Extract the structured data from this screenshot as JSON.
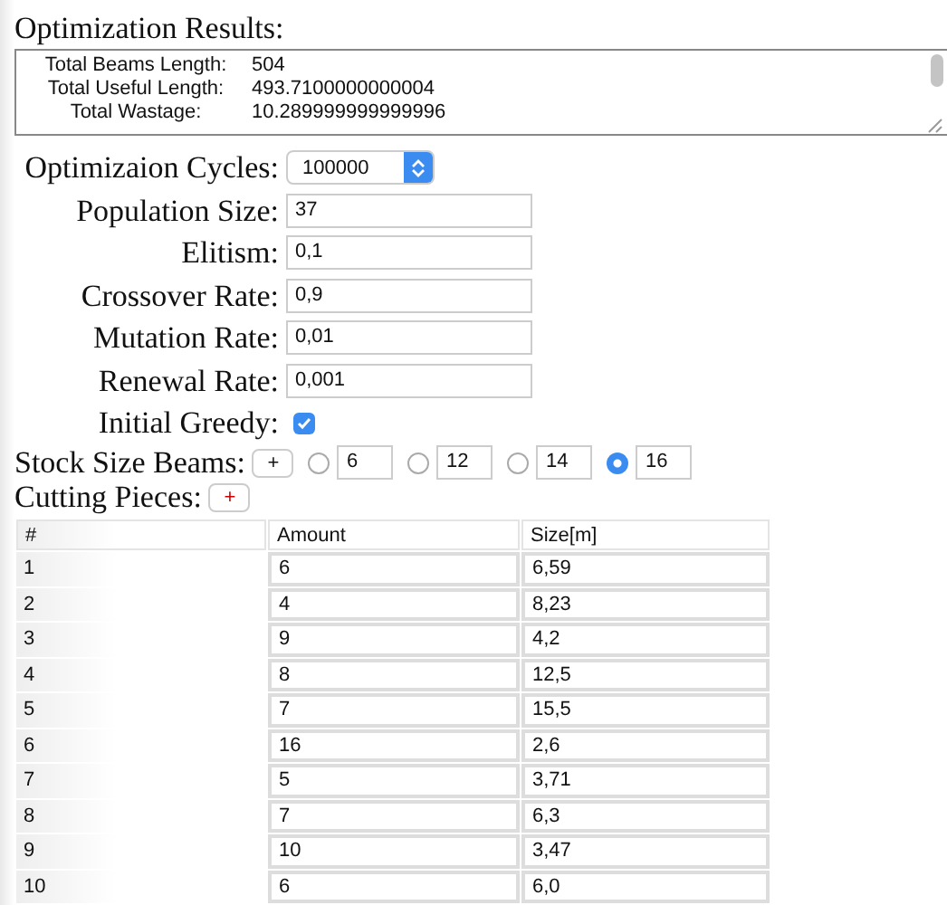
{
  "results_title": "Optimization Results:",
  "results": [
    {
      "label": "Total Beams Length:",
      "value": "504"
    },
    {
      "label": "Total Useful Length:",
      "value": "493.7100000000004"
    },
    {
      "label": "Total Wastage:",
      "value": "10.289999999999996"
    }
  ],
  "cycles": {
    "label": "Optimizaion Cycles:",
    "value": "100000"
  },
  "parameters": [
    {
      "label": "Population Size:",
      "value": "37"
    },
    {
      "label": "Elitism:",
      "value": "0,1"
    },
    {
      "label": "Crossover Rate:",
      "value": "0,9"
    },
    {
      "label": "Mutation Rate:",
      "value": "0,01"
    },
    {
      "label": "Renewal Rate:",
      "value": "0,001"
    }
  ],
  "initial_greedy": {
    "label": "Initial Greedy:",
    "checked": true
  },
  "stock_sizes": {
    "label": "Stock Size Beams:",
    "add_button": "+",
    "options": [
      {
        "value": "6",
        "selected": false
      },
      {
        "value": "12",
        "selected": false
      },
      {
        "value": "14",
        "selected": false
      },
      {
        "value": "16",
        "selected": true
      }
    ]
  },
  "cutting_pieces": {
    "label": "Cutting Pieces:",
    "add_button": "+",
    "columns": [
      "#",
      "Amount",
      "Size[m]"
    ],
    "rows": [
      [
        "1",
        "6",
        "6,59"
      ],
      [
        "2",
        "4",
        "8,23"
      ],
      [
        "3",
        "9",
        "4,2"
      ],
      [
        "4",
        "8",
        "12,5"
      ],
      [
        "5",
        "7",
        "15,5"
      ],
      [
        "6",
        "16",
        "2,6"
      ],
      [
        "7",
        "5",
        "3,71"
      ],
      [
        "8",
        "7",
        "6,3"
      ],
      [
        "9",
        "10",
        "3,47"
      ],
      [
        "10",
        "6",
        "6,0"
      ]
    ]
  }
}
